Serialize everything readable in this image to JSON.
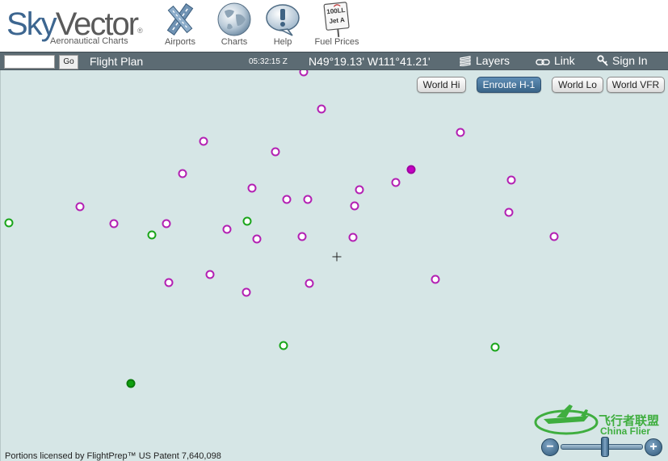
{
  "header": {
    "logo_sky": "Sky",
    "logo_vector": "Vector",
    "logo_reg": "®",
    "logo_subtitle": "Aeronautical Charts",
    "nav": [
      {
        "label": "Airports",
        "icon": "airport-runway-icon"
      },
      {
        "label": "Charts",
        "icon": "globe-icon"
      },
      {
        "label": "Help",
        "icon": "help-speech-bubble-icon"
      },
      {
        "label": "Fuel Prices",
        "icon": "fuel-sign-icon",
        "sign_lines": [
          "100LL",
          "Jet A"
        ]
      }
    ]
  },
  "toolbar": {
    "search_value": "",
    "go_label": "Go",
    "flight_plan": "Flight Plan",
    "clock": "05:32:15 Z",
    "coordinates": "N49°19.13' W111°41.21'",
    "layers": "Layers",
    "link": "Link",
    "sign_in": "Sign In"
  },
  "map": {
    "chart_buttons": [
      {
        "label": "World Hi",
        "active": false
      },
      {
        "label": "Enroute H-1",
        "active": true
      },
      {
        "label": "World Lo",
        "active": false
      },
      {
        "label": "World VFR",
        "active": false
      }
    ],
    "license": "Portions licensed by FlightPrep™ US Patent 7,640,098",
    "watermark_cn": "飞行者联盟",
    "watermark_en": "China Flier",
    "zoom_out": "−",
    "zoom_in": "+"
  },
  "colors": {
    "purple_waypoint": "#b320b3",
    "green_waypoint": "#1aa51a",
    "map_background": "#d6e6e6",
    "toolbar": "#5c6b73",
    "active_chart_button": "#3a6588"
  }
}
